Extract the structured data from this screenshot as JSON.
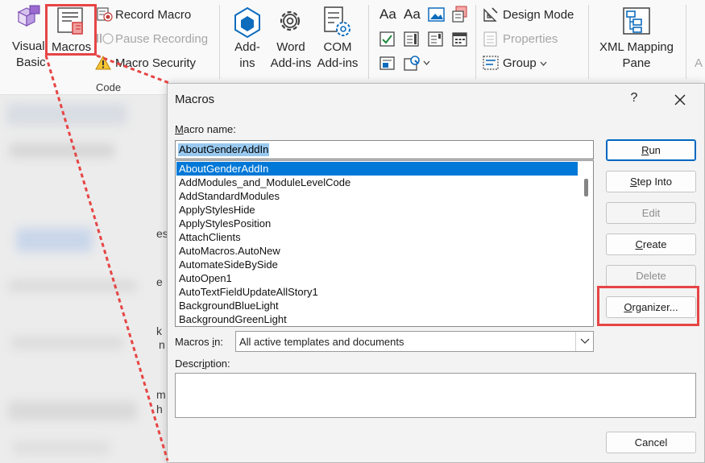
{
  "ribbon": {
    "visual_basic_line1": "Visual",
    "visual_basic_line2": "Basic",
    "macros": "Macros",
    "record_macro": "Record Macro",
    "pause_recording": "Pause Recording",
    "macro_security": "Macro Security",
    "code_group": "Code",
    "addins_line1": "Add-",
    "addins_line2": "ins",
    "word_addins_line1": "Word",
    "word_addins_line2": "Add-ins",
    "com_addins_line1": "COM",
    "com_addins_line2": "Add-ins",
    "design_mode": "Design Mode",
    "properties": "Properties",
    "group": "Group",
    "xml_line1": "XML Mapping",
    "xml_line2": "Pane",
    "aa1": "Aa",
    "aa2": "Aa",
    "cut_off": "A"
  },
  "dialog": {
    "title": "Macros",
    "help": "?",
    "macro_name_label_first": "M",
    "macro_name_label_rest": "acro name:",
    "macro_name_value": "AboutGenderAddIn",
    "macros": [
      "AboutGenderAddIn",
      "AddModules_and_ModuleLevelCode",
      "AddStandardModules",
      "ApplyStylesHide",
      "ApplyStylesPosition",
      "AttachClients",
      "AutoMacros.AutoNew",
      "AutomateSideBySide",
      "AutoOpen1",
      "AutoTextFieldUpdateAllStory1",
      "BackgroundBlueLight",
      "BackgroundGreenLight"
    ],
    "macros_in_label_first": "Macros ",
    "macros_in_label_u": "i",
    "macros_in_label_rest": "n:",
    "macros_in_value": "All active templates and documents",
    "description_label_first": "Descr",
    "description_label_u": "i",
    "description_label_rest": "ption:",
    "buttons": {
      "run_u": "R",
      "run_rest": "un",
      "step_u": "S",
      "step_rest": "tep Into",
      "edit": "Edit",
      "create_u": "C",
      "create_rest": "reate",
      "delete": "Delete",
      "organizer_u": "O",
      "organizer_rest": "rganizer...",
      "cancel": "Cancel"
    }
  },
  "background": {
    "chars": [
      "es",
      "e",
      "k",
      "n",
      "m",
      "h"
    ]
  },
  "colors": {
    "accent": "#0078d7",
    "annotation": "#e64545"
  }
}
